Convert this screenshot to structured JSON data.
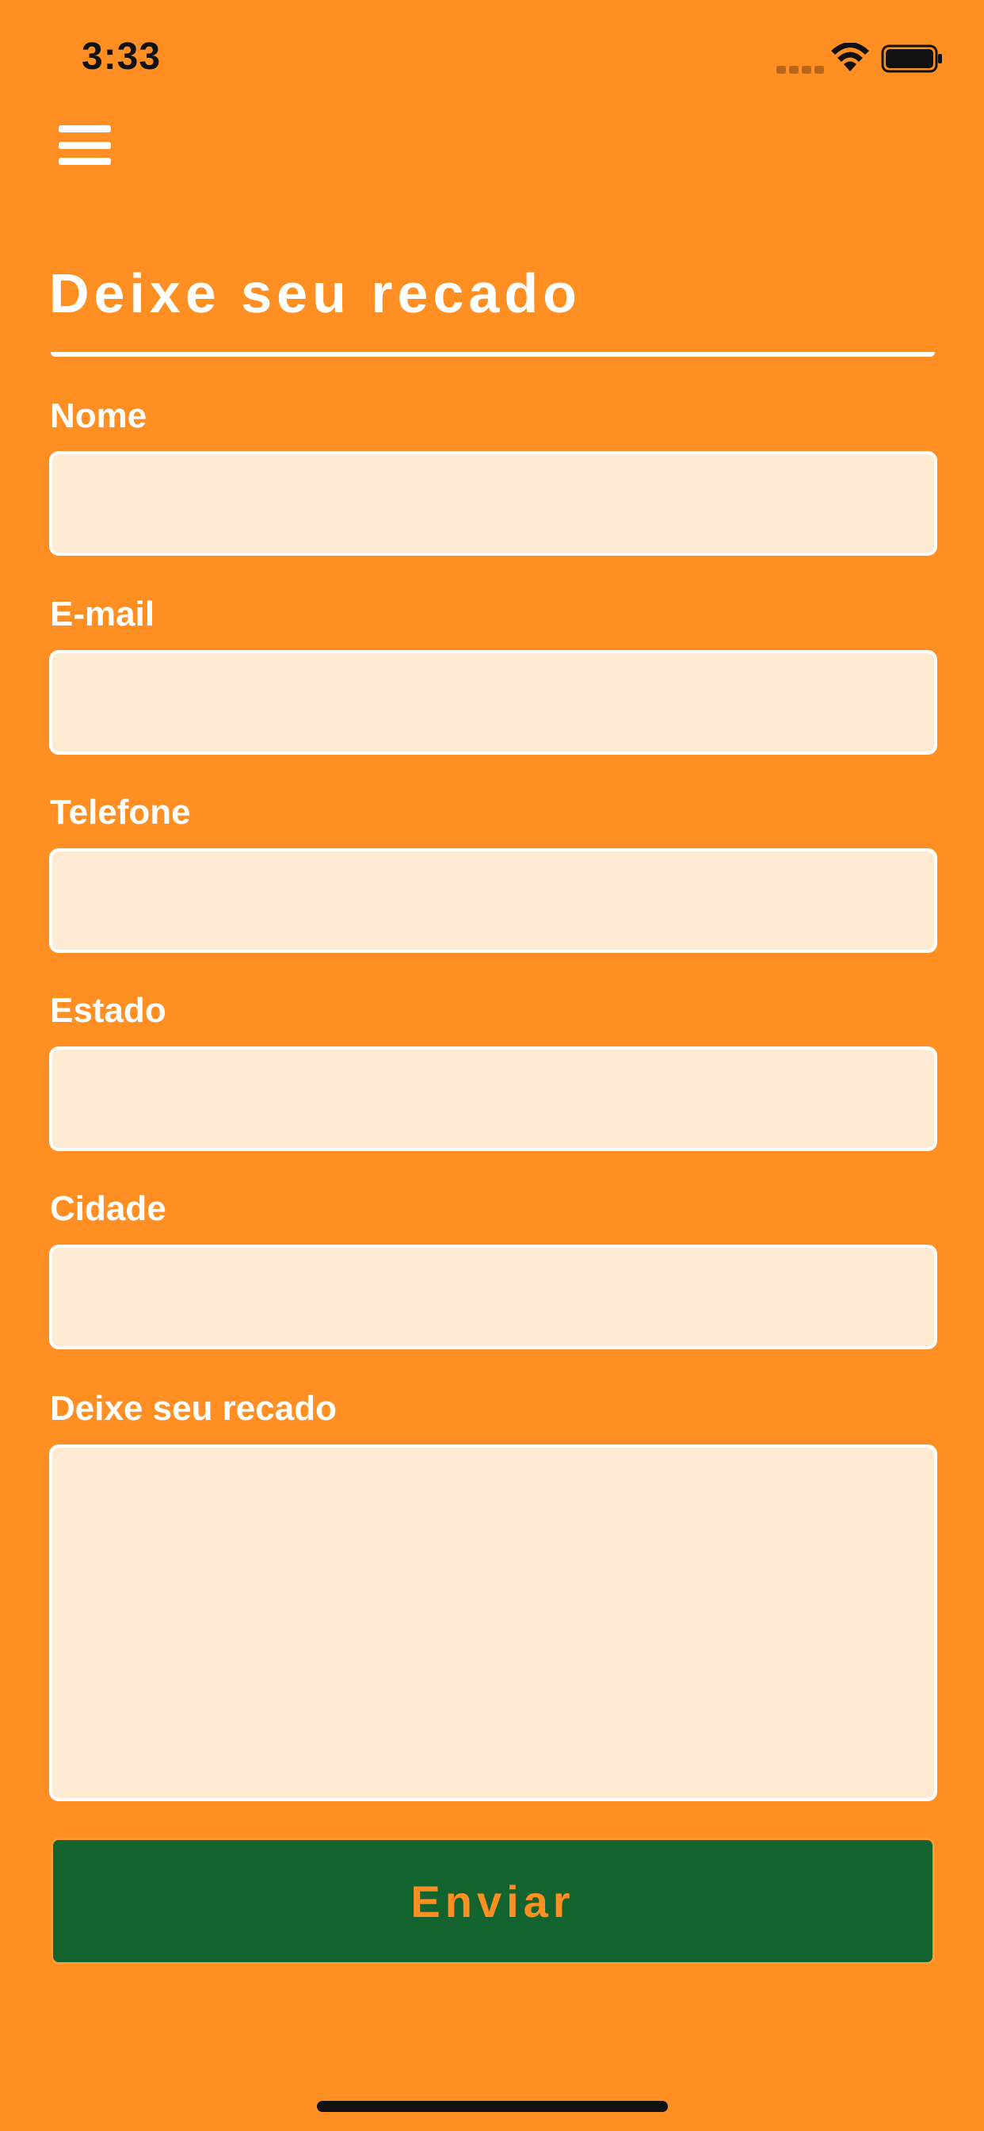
{
  "status_bar": {
    "time": "3:33",
    "icons": [
      "signal-icon",
      "wifi-icon",
      "battery-icon"
    ]
  },
  "header": {
    "menu_icon": "hamburger-menu-icon"
  },
  "page": {
    "title": "Deixe seu recado"
  },
  "form": {
    "fields": [
      {
        "label": "Nome",
        "value": "",
        "placeholder": ""
      },
      {
        "label": "E-mail",
        "value": "",
        "placeholder": ""
      },
      {
        "label": "Telefone",
        "value": "",
        "placeholder": ""
      },
      {
        "label": "Estado",
        "value": "",
        "placeholder": ""
      },
      {
        "label": "Cidade",
        "value": "",
        "placeholder": ""
      }
    ],
    "message": {
      "label": "Deixe seu recado",
      "value": "",
      "placeholder": ""
    },
    "submit_label": "Enviar"
  },
  "colors": {
    "background": "#FF8F22",
    "input_fill": "#FFEBD3",
    "button_fill": "#12632E",
    "button_text": "#FF8F22",
    "text": "#FFFFFF"
  }
}
